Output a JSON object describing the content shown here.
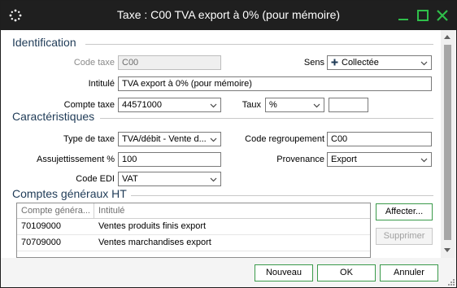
{
  "window": {
    "title": "Taxe : C00 TVA export à 0% (pour mémoire)"
  },
  "sections": {
    "identification": "Identification",
    "caracteristiques": "Caractéristiques",
    "comptes": "Comptes généraux HT"
  },
  "identification": {
    "code_taxe_label": "Code taxe",
    "code_taxe_value": "C00",
    "sens_label": "Sens",
    "sens_value": "Collectée",
    "intitule_label": "Intitulé",
    "intitule_value": "TVA export à 0% (pour mémoire)",
    "compte_taxe_label": "Compte taxe",
    "compte_taxe_value": "44571000",
    "taux_label": "Taux",
    "taux_unit": "%",
    "taux_value": ""
  },
  "caracteristiques": {
    "type_taxe_label": "Type de taxe",
    "type_taxe_value": "TVA/débit - Vente d...",
    "code_regroupement_label": "Code regroupement",
    "code_regroupement_value": "C00",
    "assujettissement_label": "Assujettissement %",
    "assujettissement_value": "100",
    "provenance_label": "Provenance",
    "provenance_value": "Export",
    "code_edi_label": "Code EDI",
    "code_edi_value": "VAT"
  },
  "comptes": {
    "columns": [
      "Compte généra...",
      "Intitulé"
    ],
    "rows": [
      {
        "compte": "70109000",
        "intitule": "Ventes produits finis export"
      },
      {
        "compte": "70709000",
        "intitule": "Ventes marchandises export"
      }
    ],
    "affecter_label": "Affecter...",
    "supprimer_label": "Supprimer"
  },
  "footer": {
    "nouveau_label": "Nouveau",
    "ok_label": "OK",
    "annuler_label": "Annuler"
  },
  "colors": {
    "accent_green": "#3a9a4a",
    "titlebar": "#1f1f1f",
    "section_text": "#1f3b57"
  }
}
